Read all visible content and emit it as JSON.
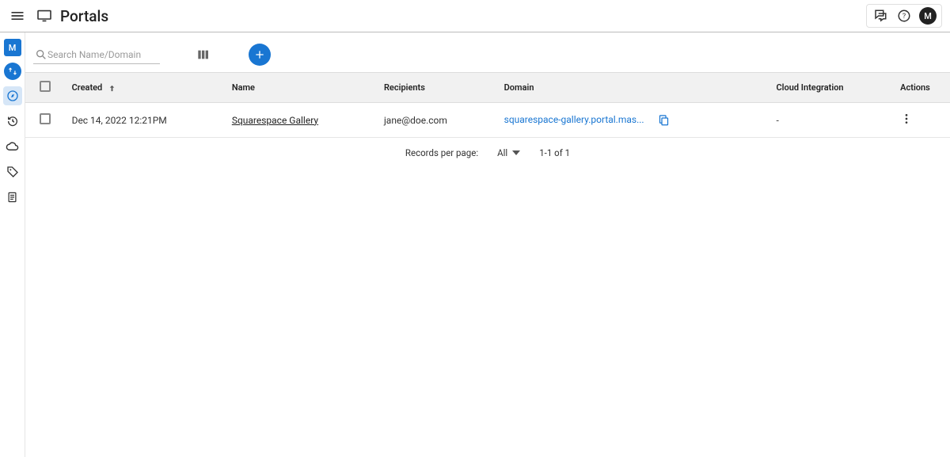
{
  "header": {
    "title": "Portals",
    "avatar_letter": "M"
  },
  "sidebar": {
    "avatar_letter": "M"
  },
  "toolbar": {
    "search_placeholder": "Search Name/Domain"
  },
  "table": {
    "columns": {
      "created": "Created",
      "name": "Name",
      "recipients": "Recipients",
      "domain": "Domain",
      "cloud": "Cloud Integration",
      "actions": "Actions"
    },
    "rows": [
      {
        "created": "Dec 14, 2022 12:21PM",
        "name": "Squarespace Gallery",
        "recipients": "jane@doe.com",
        "domain": "squarespace-gallery.portal.mas...",
        "cloud": "-"
      }
    ]
  },
  "pagination": {
    "label": "Records per page:",
    "size": "All",
    "range": "1-1 of 1"
  }
}
